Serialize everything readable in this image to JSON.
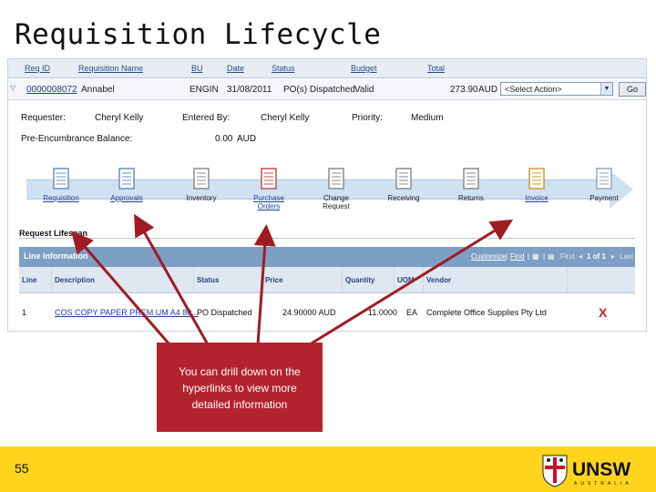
{
  "slide": {
    "title": "Requisition Lifecycle",
    "page_number": "55"
  },
  "header": {
    "columns": [
      "Req ID",
      "Requisition Name",
      "BU",
      "Date",
      "Status",
      "Budget",
      "Total"
    ]
  },
  "requisition": {
    "req_id": "0000008072",
    "name": "Annabel",
    "bu": "ENGIN",
    "date": "31/08/2011",
    "status": "PO(s) Dispatched",
    "budget": "Valid",
    "total": "273.90",
    "currency": "AUD",
    "action_select": "<Select Action>",
    "go_label": "Go",
    "requester_label": "Requester:",
    "requester": "Cheryl Kelly",
    "entered_by_label": "Entered By:",
    "entered_by": "Cheryl Kelly",
    "priority_label": "Priority:",
    "priority": "Medium",
    "pre_enc_label": "Pre-Encumbrance Balance:",
    "pre_enc_amount": "0.00",
    "pre_enc_currency": "AUD"
  },
  "lifecycle": {
    "steps": [
      {
        "label_line1": "Requisition",
        "label_line2": "",
        "is_link": true,
        "icon": "document-icon"
      },
      {
        "label_line1": "Approvals",
        "label_line2": "",
        "is_link": true,
        "icon": "checked-document-icon"
      },
      {
        "label_line1": "Inventory",
        "label_line2": "",
        "is_link": false,
        "icon": "inventory-icon"
      },
      {
        "label_line1": "Purchase",
        "label_line2": "Orders",
        "is_link": true,
        "icon": "purchase-order-icon"
      },
      {
        "label_line1": "Change",
        "label_line2": "Request",
        "is_link": false,
        "icon": "change-request-icon"
      },
      {
        "label_line1": "Receiving",
        "label_line2": "",
        "is_link": false,
        "icon": "receiving-icon"
      },
      {
        "label_line1": "Returns",
        "label_line2": "",
        "is_link": false,
        "icon": "returns-icon"
      },
      {
        "label_line1": "Invoice",
        "label_line2": "",
        "is_link": true,
        "icon": "invoice-icon"
      },
      {
        "label_line1": "Payment",
        "label_line2": "",
        "is_link": false,
        "icon": "payment-icon"
      }
    ]
  },
  "lifespan": {
    "title": "Request Lifespan",
    "grid_title": "Line Information",
    "customize": "Customize",
    "find": "Find",
    "first": "First",
    "page_info": "1 of 1",
    "last": "Last",
    "columns": [
      "Line",
      "Description",
      "Status",
      "Price",
      "Quantity",
      "UOM",
      "Vendor"
    ],
    "rows": [
      {
        "line": "1",
        "description": "COS COPY PAPER PREM UM A4 80...",
        "status": "PO Dispatched",
        "price": "24.90000 AUD",
        "quantity": "11.0000",
        "uom": "EA",
        "vendor": "Complete Office Supplies Pty Ltd"
      }
    ],
    "delete_mark": "X"
  },
  "callout": {
    "line1": "You can drill down on the",
    "line2": "hyperlinks to view more",
    "line3": "detailed information"
  },
  "logo": {
    "text": "UNSW",
    "subtext": "AUSTRALIA"
  },
  "colors": {
    "callout_bg": "#b2232e",
    "footer_bg": "#ffd41c",
    "arrow": "#a01c24",
    "grid_title_bg": "#7d9fc4"
  }
}
